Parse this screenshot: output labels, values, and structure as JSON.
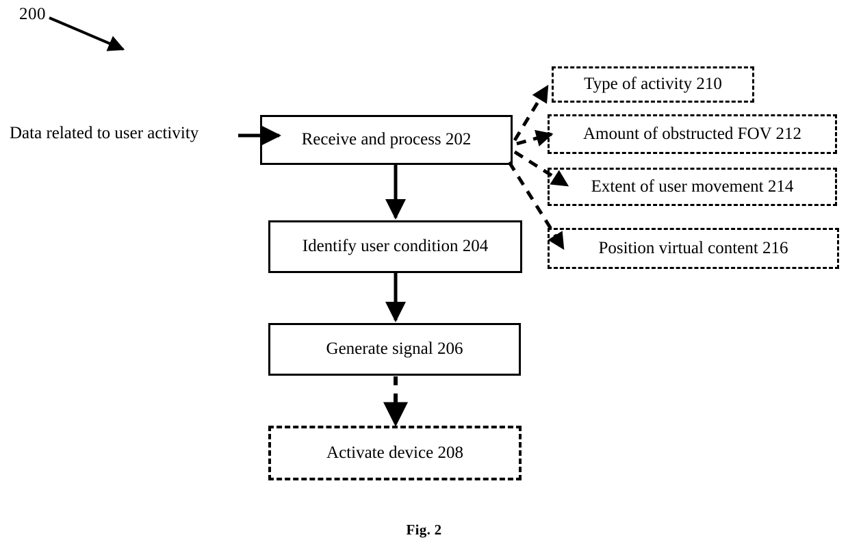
{
  "figure": {
    "reference_numeral": "200",
    "caption": "Fig. 2"
  },
  "input": {
    "label": "Data related to user activity"
  },
  "process_steps": [
    {
      "id": "202",
      "label": "Receive and process 202",
      "style": "solid"
    },
    {
      "id": "204",
      "label": "Identify user condition 204",
      "style": "solid"
    },
    {
      "id": "206",
      "label": "Generate signal 206",
      "style": "solid"
    },
    {
      "id": "208",
      "label": "Activate device 208",
      "style": "dashed"
    }
  ],
  "attributes": [
    {
      "id": "210",
      "label": "Type of activity  210",
      "style": "dashed"
    },
    {
      "id": "212",
      "label": "Amount of obstructed FOV  212",
      "style": "dashed"
    },
    {
      "id": "214",
      "label": "Extent of user movement  214",
      "style": "dashed"
    },
    {
      "id": "216",
      "label": "Position virtual content  216",
      "style": "dashed"
    }
  ],
  "colors": {
    "line": "#000000",
    "background": "#ffffff"
  }
}
